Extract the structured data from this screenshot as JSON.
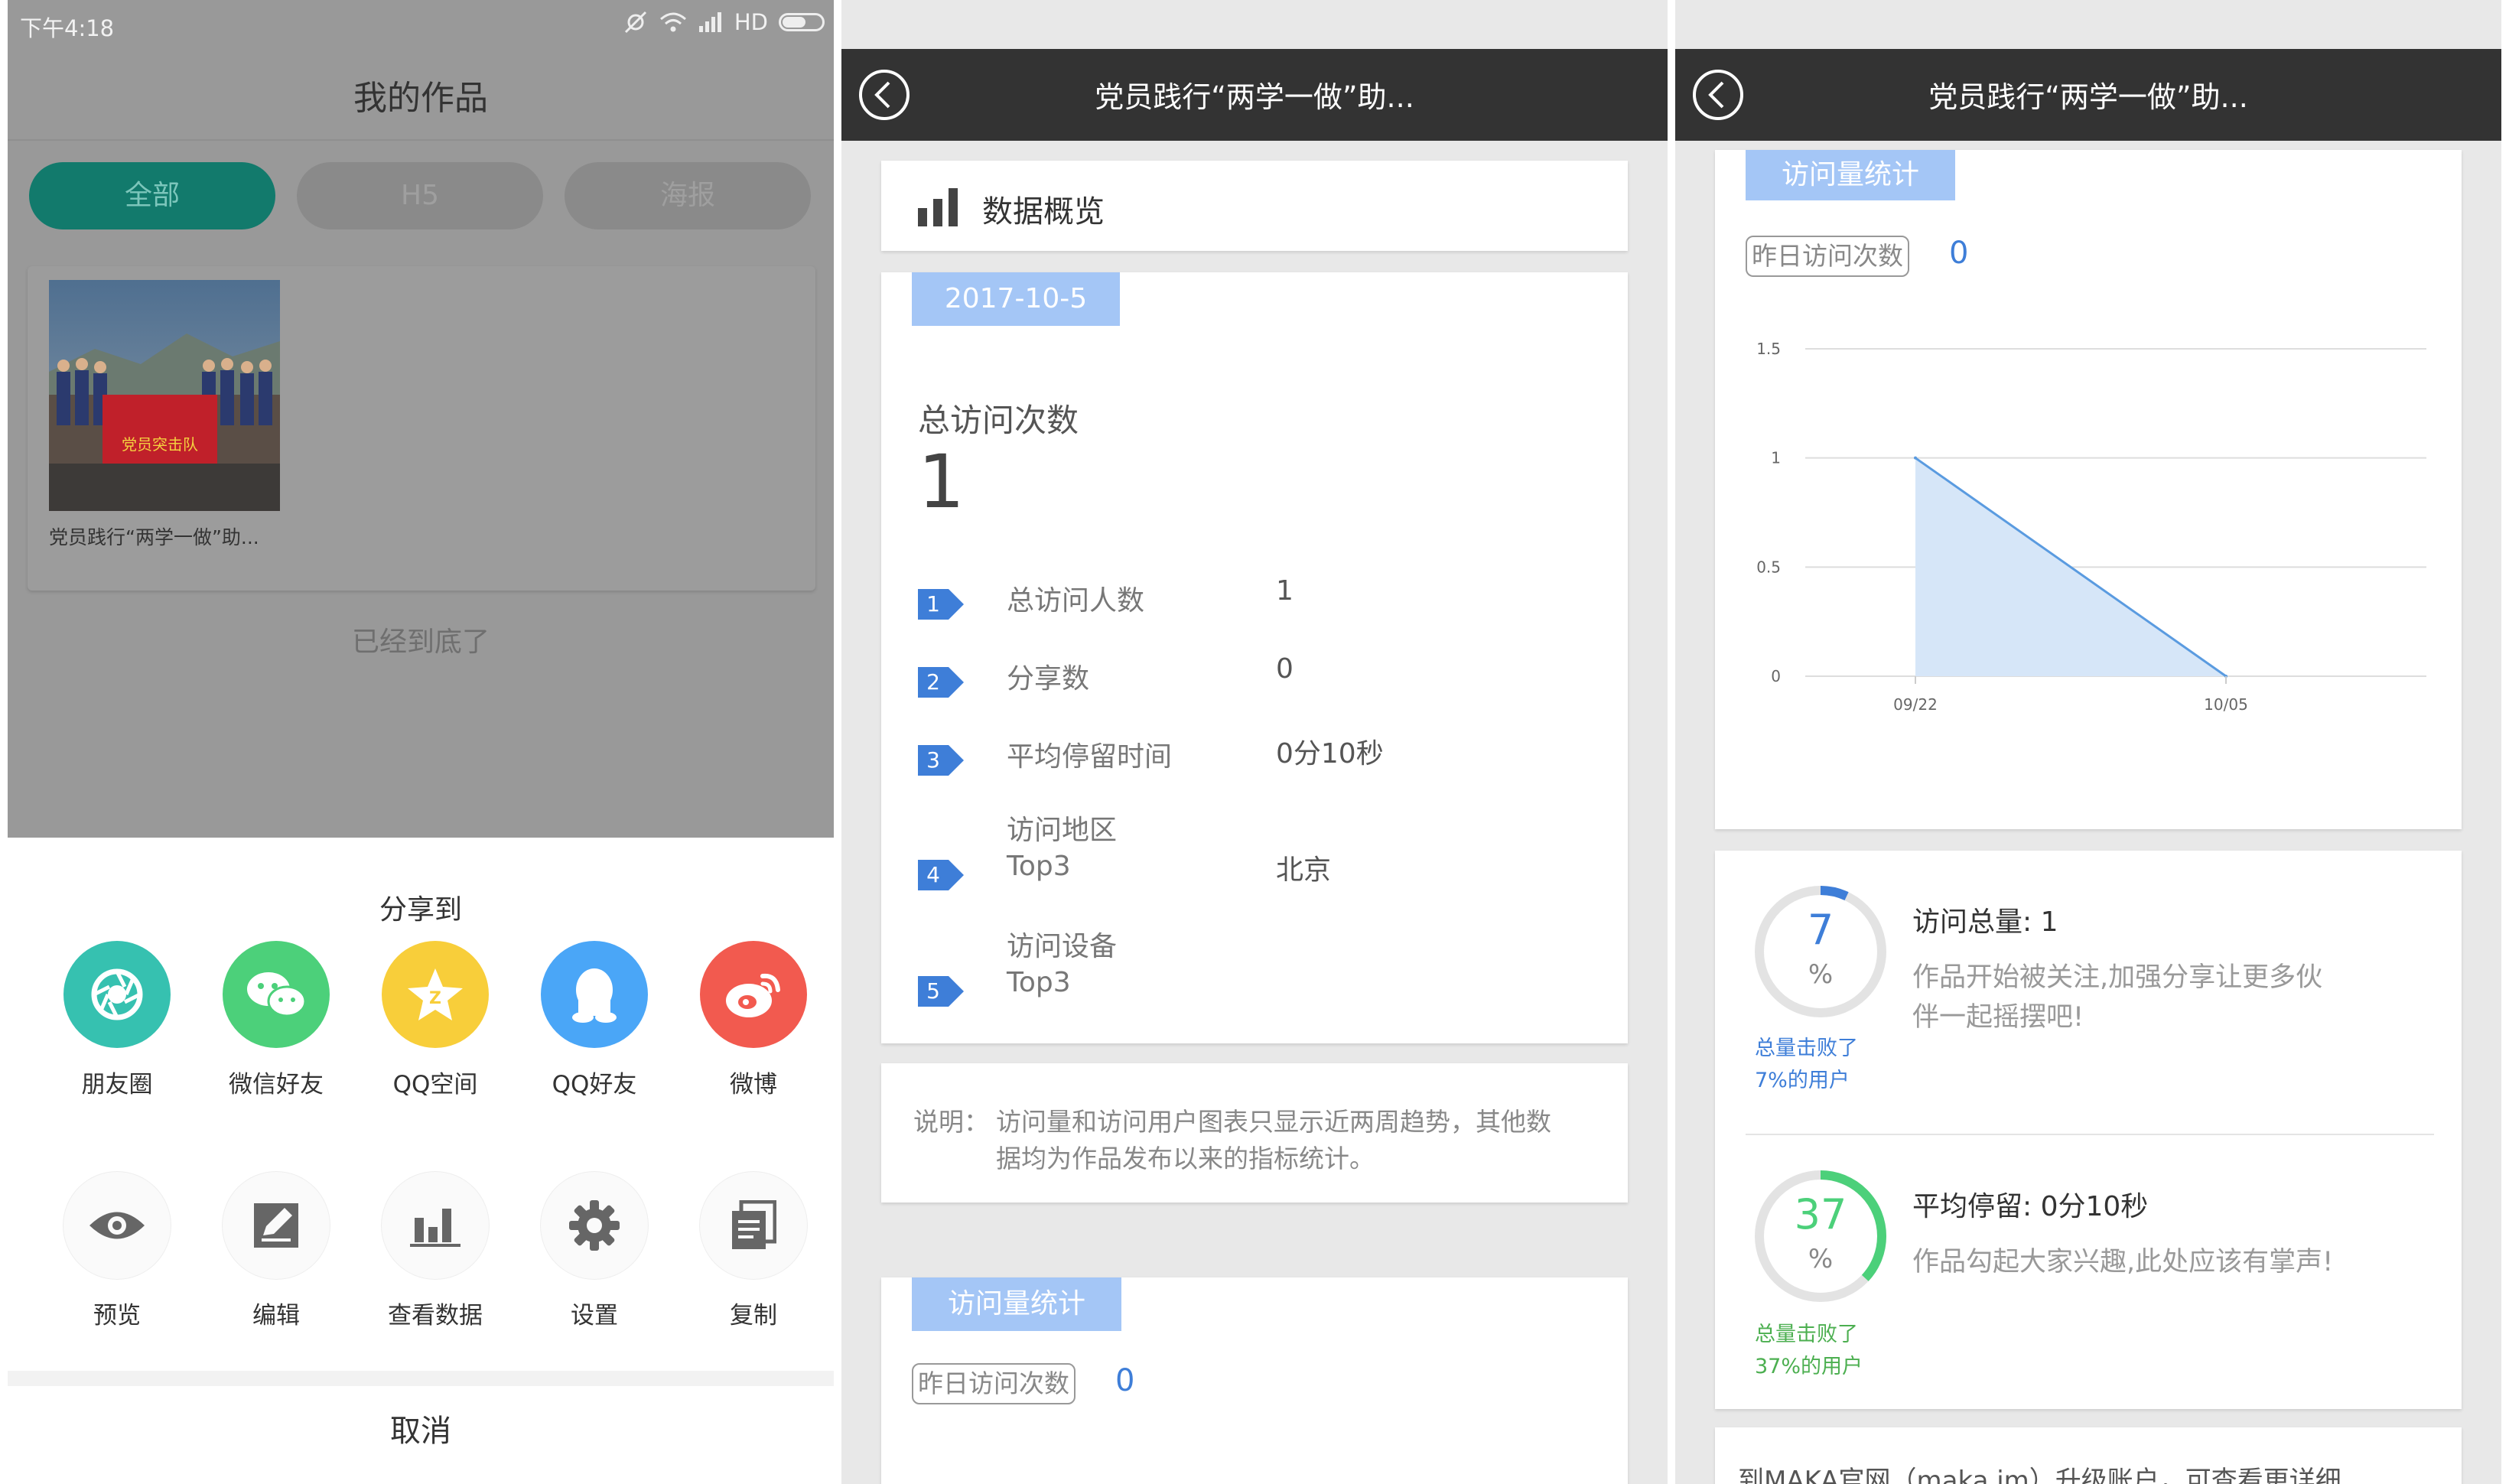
{
  "panel1": {
    "status": {
      "time": "下午4:18",
      "network": "HD"
    },
    "title": "我的作品",
    "tabs": [
      "全部",
      "H5",
      "海报"
    ],
    "work": {
      "title": "党员践行“两学一做”助...",
      "banner_text": "党员突击队"
    },
    "bottom_tip": "已经到底了",
    "share_title": "分享到",
    "share_targets": [
      {
        "label": "朋友圈",
        "icon": "moments-icon",
        "color": "#36c1b0"
      },
      {
        "label": "微信好友",
        "icon": "wechat-icon",
        "color": "#4cd07a"
      },
      {
        "label": "QQ空间",
        "icon": "qzone-icon",
        "color": "#f8ce3a"
      },
      {
        "label": "QQ好友",
        "icon": "qq-icon",
        "color": "#4aa6f7"
      },
      {
        "label": "微博",
        "icon": "weibo-icon",
        "color": "#f25a4f"
      }
    ],
    "actions": [
      {
        "label": "预览",
        "icon": "eye-icon"
      },
      {
        "label": "编辑",
        "icon": "edit-icon"
      },
      {
        "label": "查看数据",
        "icon": "bar-chart-icon"
      },
      {
        "label": "设置",
        "icon": "gear-icon"
      },
      {
        "label": "复制",
        "icon": "copy-icon"
      }
    ],
    "cancel": "取消"
  },
  "panel2": {
    "nav_title": "党员践行“两学一做”助...",
    "overview_title": "数据概览",
    "date": "2017-10-5",
    "total_label": "总访问次数",
    "total_value": "1",
    "rows": [
      {
        "num": "1",
        "label": "总访问人数",
        "value": "1"
      },
      {
        "num": "2",
        "label": "分享数",
        "value": "0"
      },
      {
        "num": "3",
        "label": "平均停留时间",
        "value": "0分10秒"
      },
      {
        "num": "4",
        "label_line1": "访问地区",
        "label_line2": "Top3",
        "value": "北京"
      },
      {
        "num": "5",
        "label_line1": "访问设备",
        "label_line2": "Top3",
        "value": ""
      }
    ],
    "note_prefix": "说明：",
    "note_line1": "访问量和访问用户图表只显示近两周趋势，其他数",
    "note_line2": "据均为作品发布以来的指标统计。",
    "stats_tag": "访问量统计",
    "yesterday_label": "昨日访问次数",
    "yesterday_value": "0"
  },
  "panel3": {
    "nav_title": "党员践行“两学一做”助...",
    "stats_tag": "访问量统计",
    "yesterday_label": "昨日访问次数",
    "yesterday_value": "0",
    "visits_card": {
      "percent": "7",
      "percent_unit": "%",
      "beat_line1": "总量击败了",
      "beat_line2": "7%的用户",
      "title": "访问总量: 1",
      "desc_line1": "作品开始被关注,加强分享让更多伙",
      "desc_line2": "伴一起摇摆吧!",
      "ring_fraction": 0.07,
      "color": "#3e7ed8"
    },
    "stay_card": {
      "percent": "37",
      "percent_unit": "%",
      "beat_line1": "总量击败了",
      "beat_line2": "37%的用户",
      "title": "平均停留: 0分10秒",
      "desc_line1": "作品勾起大家兴趣,此处应该有掌声!",
      "ring_fraction": 0.37,
      "color": "#4cd07a"
    },
    "footer_partial": "到MAKA官网（maka.im）升级账户，可查看更详细"
  },
  "chart_data": {
    "type": "area",
    "x": [
      "09/22",
      "10/05"
    ],
    "series": [
      {
        "values": [
          1,
          0
        ]
      }
    ],
    "ylim": [
      0,
      1.5
    ],
    "yticks": [
      "0",
      "0.5",
      "1",
      "1.5"
    ],
    "grid": true,
    "color": "#5a9be0"
  }
}
